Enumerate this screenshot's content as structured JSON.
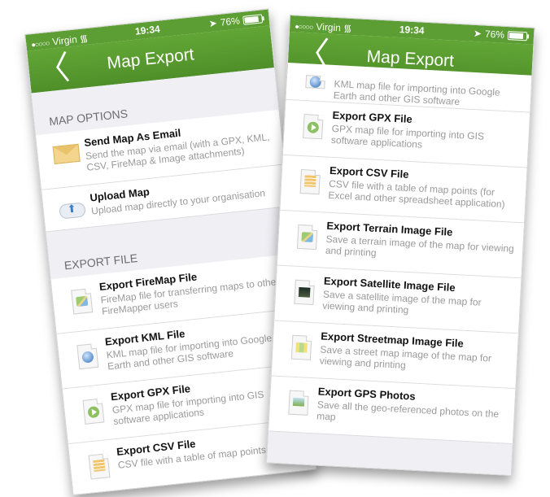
{
  "status": {
    "carrier": "Virgin",
    "signal": "●○○○○",
    "time": "19:34",
    "battery": "76%",
    "battery_level": 0.76
  },
  "navbar": {
    "title": "Map Export",
    "back": "〈"
  },
  "colors": {
    "accent": "#5c9e33",
    "background": "#efeff4",
    "subtitle": "#9a9a9a"
  },
  "left": {
    "map_options_header": "MAP OPTIONS",
    "send_email": {
      "title": "Send Map As Email",
      "subtitle": "Send the map via email (with a GPX, KML, CSV, FireMap & Image attachments)"
    },
    "upload": {
      "title": "Upload Map",
      "subtitle": "Upload map directly to your organisation"
    },
    "export_header": "EXPORT FILE",
    "firemap": {
      "title": "Export FireMap File",
      "subtitle": "FireMap file for transferring maps to other FireMapper users"
    },
    "kml": {
      "title": "Export KML File",
      "subtitle": "KML map file for importing into Google Earth and other GIS software"
    },
    "gpx": {
      "title": "Export GPX File",
      "subtitle": "GPX map file for importing into GIS software applications"
    },
    "csv": {
      "title": "Export CSV File",
      "subtitle": "CSV file with a table of map points"
    }
  },
  "right": {
    "kml_partial": {
      "subtitle": "KML map file for importing into Google Earth and other GIS software"
    },
    "gpx": {
      "title": "Export GPX File",
      "subtitle": "GPX map file for importing into GIS software applications"
    },
    "csv": {
      "title": "Export CSV File",
      "subtitle": "CSV file with a table of map points (for Excel and other spreadsheet application)"
    },
    "terrain": {
      "title": "Export Terrain Image File",
      "subtitle": "Save a terrain image of the map for viewing and printing"
    },
    "satellite": {
      "title": "Export Satellite Image File",
      "subtitle": "Save a satellite image of the map for viewing and printing"
    },
    "streetmap": {
      "title": "Export Streetmap Image File",
      "subtitle": "Save a street map image of the map for viewing and printing"
    },
    "photos": {
      "title": "Export GPS Photos",
      "subtitle": "Save all the geo-referenced photos on the map"
    }
  },
  "icons": [
    "back-chevron-icon",
    "wifi-icon",
    "location-arrow-icon",
    "battery-icon",
    "envelope-icon",
    "cloud-upload-icon",
    "firemap-file-icon",
    "kml-file-icon",
    "gpx-file-icon",
    "csv-file-icon",
    "terrain-image-icon",
    "satellite-image-icon",
    "streetmap-image-icon",
    "gps-photos-icon"
  ]
}
